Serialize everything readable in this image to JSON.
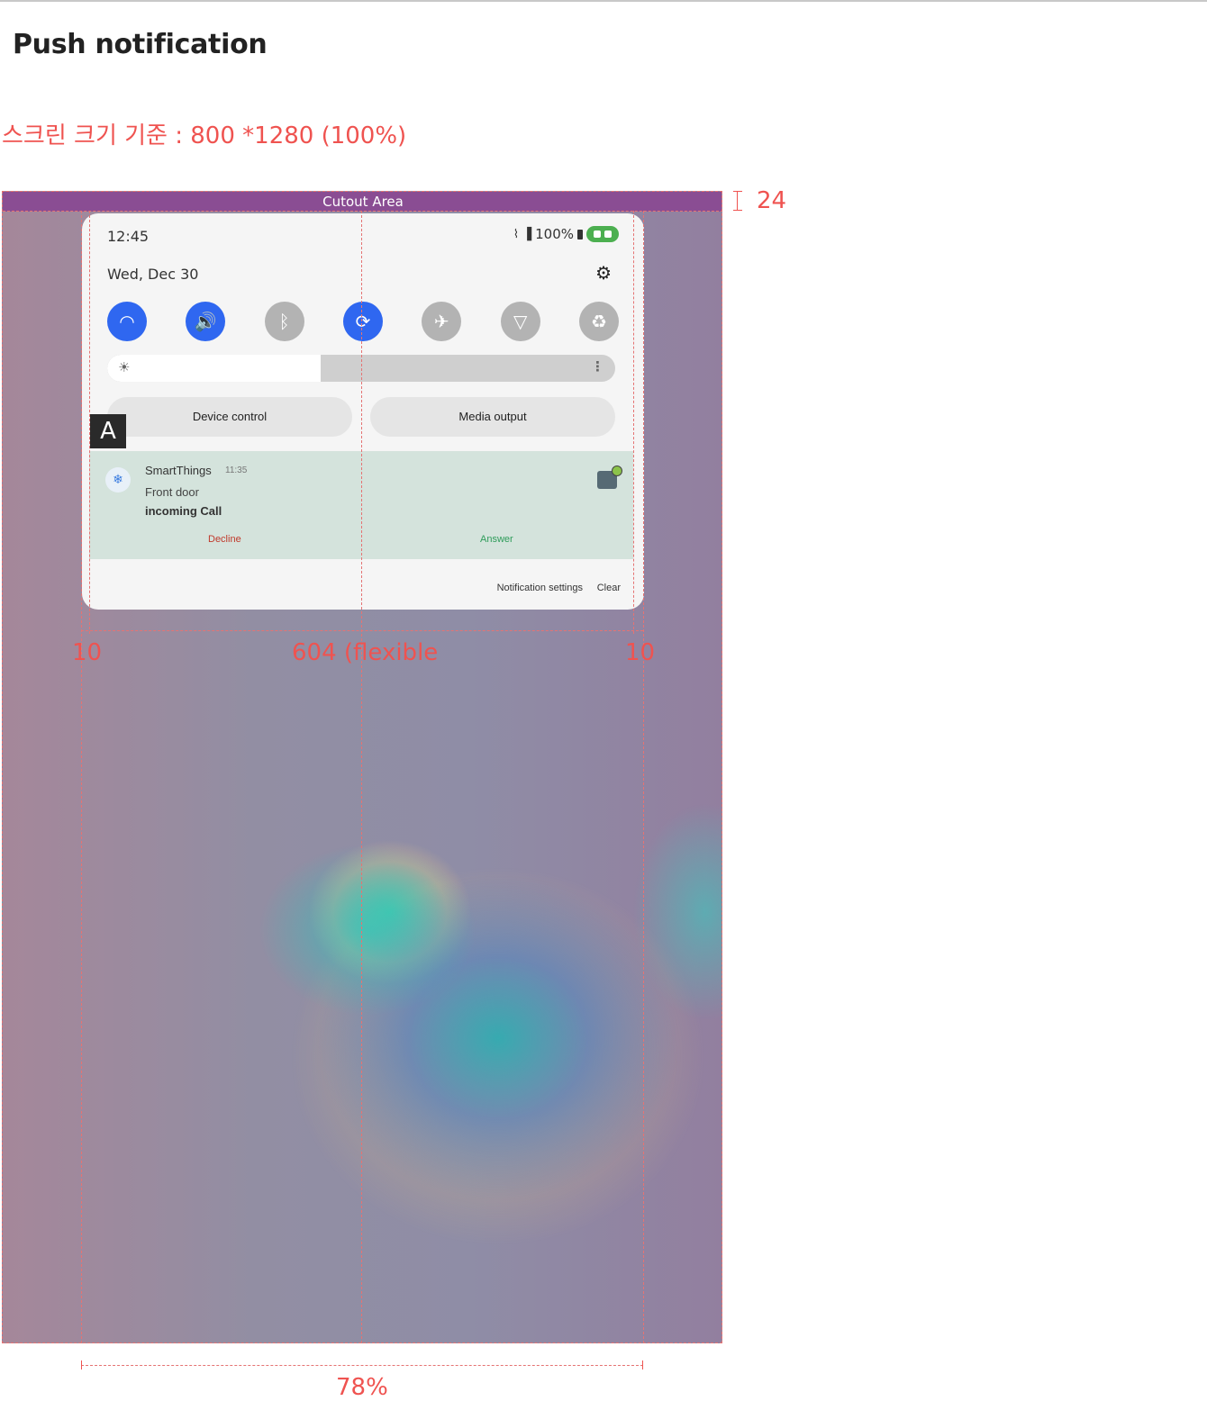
{
  "page": {
    "title": "Push notification",
    "spec_label": "스크린 크기 기준 : 800 *1280 (100%)"
  },
  "screen": {
    "cutout_label": "Cutout Area",
    "cutout_height_label": "24"
  },
  "quick_panel": {
    "time": "12:45",
    "battery": "100%",
    "date": "Wed, Dec 30",
    "tiles": [
      {
        "icon": "wifi-icon",
        "on": true
      },
      {
        "icon": "sound-icon",
        "on": true
      },
      {
        "icon": "bluetooth-icon",
        "on": false
      },
      {
        "icon": "auto-rotate-icon",
        "on": true
      },
      {
        "icon": "airplane-icon",
        "on": false
      },
      {
        "icon": "flashlight-icon",
        "on": false
      },
      {
        "icon": "power-saving-icon",
        "on": false
      }
    ],
    "brightness_level": 0.42,
    "device_control_label": "Device control",
    "media_output_label": "Media output"
  },
  "notification": {
    "app_name": "SmartThings",
    "time": "11:35",
    "title": "Front door",
    "body": "incoming Call",
    "decline_label": "Decline",
    "answer_label": "Answer"
  },
  "footer": {
    "settings_label": "Notification settings",
    "clear_label": "Clear"
  },
  "annotations": {
    "badge": "A",
    "left_margin": "10",
    "content_width": "604 (flexible",
    "right_margin": "10",
    "panel_width_ratio": "78%"
  },
  "colors": {
    "accent_on": "#2f67f0",
    "tile_off": "#b3b3b3",
    "guide": "#ef5350",
    "cutout": "#8a4d93",
    "notification_bg": "#d4e3dc"
  }
}
